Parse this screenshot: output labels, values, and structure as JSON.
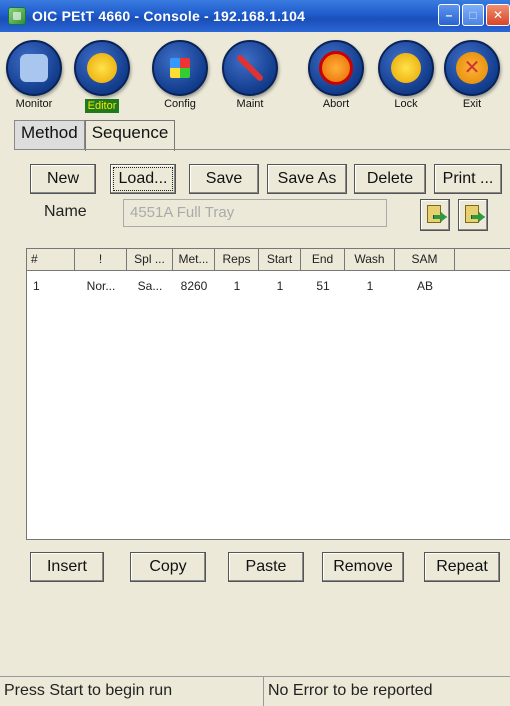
{
  "window": {
    "title": "OIC PEtT 4660 - Console - 192.168.1.104",
    "controls": [
      "minimize",
      "maximize",
      "close"
    ]
  },
  "toolbar": {
    "items": [
      {
        "label": "Monitor",
        "icon": "monitor-icon",
        "active": false
      },
      {
        "label": "Editor",
        "icon": "editor-icon",
        "active": true
      },
      {
        "label": "Config",
        "icon": "config-icon",
        "active": false
      },
      {
        "label": "Maint",
        "icon": "maint-icon",
        "active": false
      },
      {
        "label": "Abort",
        "icon": "abort-icon",
        "active": false
      },
      {
        "label": "Lock",
        "icon": "lock-icon",
        "active": false
      },
      {
        "label": "Exit",
        "icon": "exit-icon",
        "active": false
      }
    ]
  },
  "tabs": [
    {
      "label": "Method",
      "selected": false
    },
    {
      "label": "Sequence",
      "selected": true
    }
  ],
  "actions": {
    "new": "New",
    "load": "Load...",
    "save": "Save",
    "save_as": "Save As",
    "delete": "Delete",
    "print": "Print ..."
  },
  "name_field": {
    "label": "Name",
    "value": "4551A Full Tray"
  },
  "table": {
    "headers": [
      "#",
      "!",
      "Spl ...",
      "Met...",
      "Reps",
      "Start",
      "End",
      "Wash",
      "SAM"
    ],
    "rows": [
      [
        "1",
        "Nor...",
        "Sa...",
        "8260",
        "1",
        "1",
        "51",
        "1",
        "AB"
      ]
    ]
  },
  "row_actions": {
    "insert": "Insert",
    "copy": "Copy",
    "paste": "Paste",
    "remove": "Remove",
    "repeat": "Repeat"
  },
  "status": {
    "left": "Press Start to begin run",
    "right": "No Error to be reported"
  },
  "colors": {
    "titlebar": "#2a66d6",
    "toolbar_circle": "#123c8c",
    "editor_active_bg": "#1f7a1f",
    "editor_active_text": "#ffe600",
    "abort_inner": "#f0a020",
    "exit_inner": "#f0a020"
  }
}
